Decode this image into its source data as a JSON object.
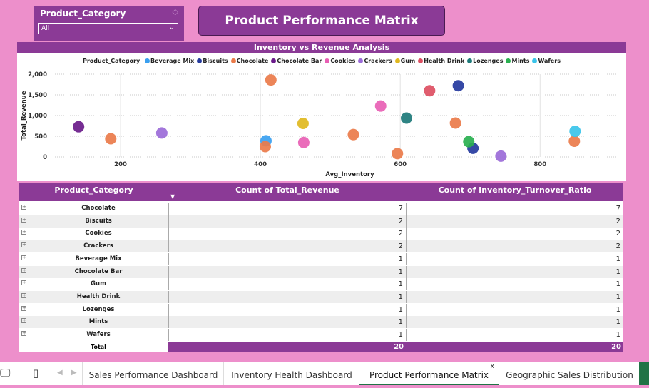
{
  "slicer": {
    "title": "Product_Category",
    "selected": "All"
  },
  "page_title": "Product Performance Matrix",
  "chart_data": {
    "type": "scatter",
    "title": "Inventory vs Revenue Analysis",
    "xlabel": "Avg_Inventory",
    "ylabel": "Total_Revenue",
    "legend_title": "Product_Category",
    "xlim": [
      100,
      915
    ],
    "ylim": [
      0,
      2000
    ],
    "xticks": [
      "200",
      "400",
      "600",
      "800"
    ],
    "yticks": [
      "0",
      "500",
      "1,000",
      "1,500",
      "2,000"
    ],
    "legend_position": "top",
    "series": [
      {
        "name": "Beverage Mix",
        "color": "#3aa0f0",
        "points": [
          [
            408,
            390
          ]
        ]
      },
      {
        "name": "Biscuits",
        "color": "#253a9e",
        "points": [
          [
            683,
            1720
          ],
          [
            704,
            210
          ]
        ]
      },
      {
        "name": "Chocolate",
        "color": "#ea7b4a",
        "points": [
          [
            186,
            440
          ],
          [
            407,
            250
          ],
          [
            415,
            1860
          ],
          [
            533,
            540
          ],
          [
            596,
            80
          ],
          [
            679,
            820
          ],
          [
            849,
            380
          ]
        ]
      },
      {
        "name": "Chocolate Bar",
        "color": "#6a1b8a",
        "points": [
          [
            140,
            730
          ]
        ]
      },
      {
        "name": "Cookies",
        "color": "#e85fb4",
        "points": [
          [
            462,
            350
          ],
          [
            572,
            1230
          ]
        ]
      },
      {
        "name": "Crackers",
        "color": "#9b6bd8",
        "points": [
          [
            259,
            580
          ],
          [
            744,
            20
          ]
        ]
      },
      {
        "name": "Gum",
        "color": "#e0b820",
        "points": [
          [
            461,
            810
          ]
        ]
      },
      {
        "name": "Health Drink",
        "color": "#dd4f62",
        "points": [
          [
            642,
            1600
          ]
        ]
      },
      {
        "name": "Lozenges",
        "color": "#1d7a7a",
        "points": [
          [
            609,
            940
          ]
        ]
      },
      {
        "name": "Mints",
        "color": "#2ab050",
        "points": [
          [
            698,
            370
          ]
        ]
      },
      {
        "name": "Wafers",
        "color": "#3ac4ea",
        "points": [
          [
            850,
            620
          ]
        ]
      }
    ]
  },
  "table": {
    "headers": [
      "Product_Category",
      "Count of Total_Revenue",
      "Count of Inventory_Turnover_Ratio"
    ],
    "rows": [
      {
        "category": "Chocolate",
        "revenue_count": "7",
        "turnover_count": "7"
      },
      {
        "category": "Biscuits",
        "revenue_count": "2",
        "turnover_count": "2"
      },
      {
        "category": "Cookies",
        "revenue_count": "2",
        "turnover_count": "2"
      },
      {
        "category": "Crackers",
        "revenue_count": "2",
        "turnover_count": "2"
      },
      {
        "category": "Beverage Mix",
        "revenue_count": "1",
        "turnover_count": "1"
      },
      {
        "category": "Chocolate Bar",
        "revenue_count": "1",
        "turnover_count": "1"
      },
      {
        "category": "Gum",
        "revenue_count": "1",
        "turnover_count": "1"
      },
      {
        "category": "Health Drink",
        "revenue_count": "1",
        "turnover_count": "1"
      },
      {
        "category": "Lozenges",
        "revenue_count": "1",
        "turnover_count": "1"
      },
      {
        "category": "Mints",
        "revenue_count": "1",
        "turnover_count": "1"
      },
      {
        "category": "Wafers",
        "revenue_count": "1",
        "turnover_count": "1"
      }
    ],
    "total_label": "Total",
    "total_revenue_count": "20",
    "total_turnover_count": "20"
  },
  "tabs": [
    {
      "label": "Sales Performance Dashboard",
      "active": false
    },
    {
      "label": "Inventory Health Dashboard",
      "active": false
    },
    {
      "label": "Product Performance Matrix",
      "active": true
    },
    {
      "label": "Geographic Sales Distribution",
      "active": false
    }
  ],
  "icons": {
    "desktop": "desktop-icon",
    "phone": "phone-icon"
  },
  "colors": {
    "accent": "#8b3a96",
    "page_bg": "#ed8fcb",
    "active_tab": "#217346"
  }
}
